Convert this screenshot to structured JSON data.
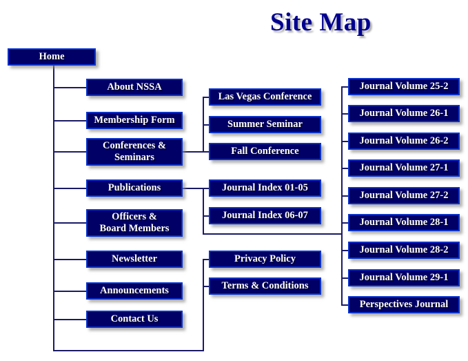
{
  "page": {
    "title": "Site Map"
  },
  "colors": {
    "title_text": "#00008f",
    "box_fill": "#000066",
    "box_border": "#0a32cc",
    "box_text": "#ffffff",
    "connector": "#1a1a66",
    "background": "#ffffff"
  },
  "root": {
    "label": "Home"
  },
  "main_nav": [
    {
      "label": "About NSSA"
    },
    {
      "label": "Membership Form"
    },
    {
      "label": "Conferences &\nSeminars"
    },
    {
      "label": "Publications"
    },
    {
      "label": "Officers &\nBoard Members"
    },
    {
      "label": "Newsletter"
    },
    {
      "label": "Announcements"
    },
    {
      "label": "Contact Us"
    }
  ],
  "conferences_children": [
    {
      "label": "Las Vegas Conference"
    },
    {
      "label": "Summer Seminar"
    },
    {
      "label": "Fall Conference"
    }
  ],
  "publications_children": [
    {
      "label": "Journal Index 01-05"
    },
    {
      "label": "Journal Index 06-07"
    }
  ],
  "legal_children": [
    {
      "label": "Privacy Policy"
    },
    {
      "label": "Terms & Conditions"
    }
  ],
  "journals": [
    {
      "label": "Journal Volume 25-2"
    },
    {
      "label": "Journal Volume 26-1"
    },
    {
      "label": "Journal Volume 26-2"
    },
    {
      "label": "Journal Volume 27-1"
    },
    {
      "label": "Journal Volume 27-2"
    },
    {
      "label": "Journal Volume 28-1"
    },
    {
      "label": "Journal Volume 28-2"
    },
    {
      "label": "Journal Volume 29-1"
    },
    {
      "label": "Perspectives Journal"
    }
  ]
}
